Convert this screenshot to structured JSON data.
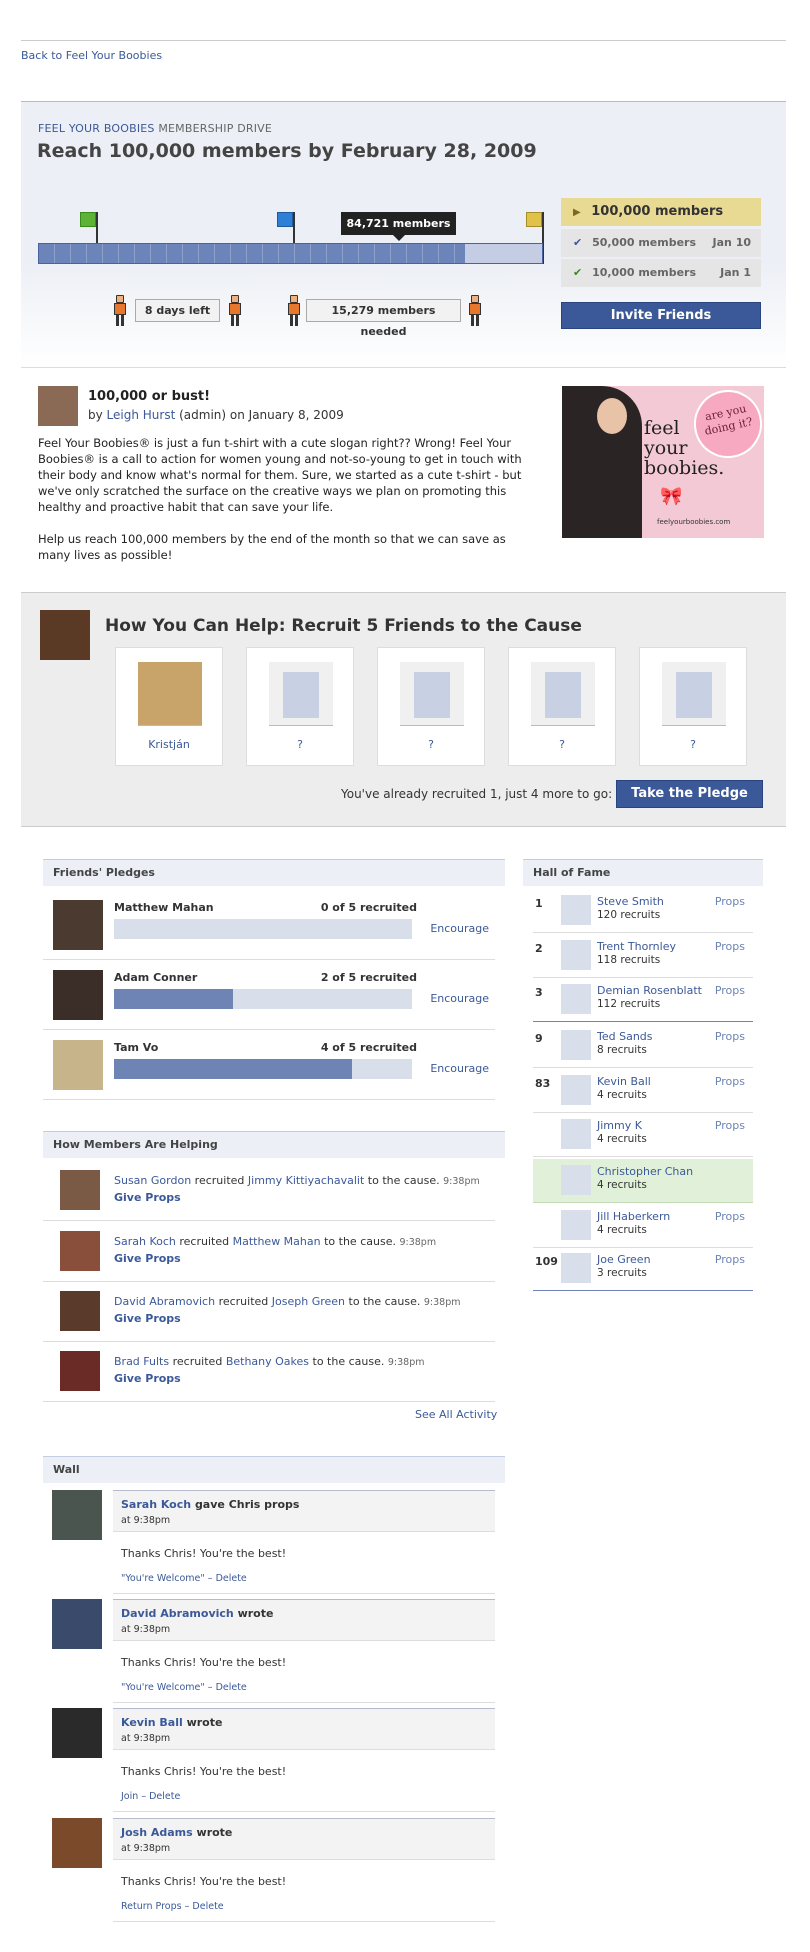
{
  "top_link": "Back to Feel Your Boobies",
  "drive": {
    "brand": "FEEL YOUR BOOBIES",
    "label": "MEMBERSHIP DRIVE",
    "title": "Reach 100,000 members by February 28, 2009",
    "progress_fraction": 0.847,
    "current_members": "84,721 members",
    "days_left": "8 days left",
    "members_needed": "15,279 members needed",
    "goals": [
      {
        "label": "100,000 members",
        "date": "",
        "state": "current"
      },
      {
        "label": "50,000 members",
        "date": "Jan 10",
        "state": "done"
      },
      {
        "label": "10,000 members",
        "date": "Jan 1",
        "state": "done"
      }
    ],
    "invite_button": "Invite Friends",
    "colors": {
      "flag_green": "#5cb335",
      "flag_blue": "#2e7fd6",
      "flag_yellow": "#e0c24a",
      "accent": "#3b5998"
    }
  },
  "post": {
    "title": "100,000 or bust!",
    "by_prefix": "by",
    "author": "Leigh Hurst",
    "by_suffix": "(admin) on January 8, 2009",
    "paragraph1": "Feel Your Boobies® is just a fun t-shirt with a cute slogan right?? Wrong! Feel Your Boobies® is a call to action for women young and not-so-young to get in touch with their body and know what's normal for them. Sure, we started as a cute t-shirt - but we've only scratched the surface on the creative ways we plan on promoting this healthy and proactive habit that can save your life.",
    "paragraph2": "Help us reach 100,000 members by the end of the month so that we can save as many lives as possible!",
    "ad": {
      "line1": "feel",
      "line2": "your",
      "line3": "boobies.",
      "badge": "are you doing it?",
      "url": "feelyourboobies.com"
    }
  },
  "recruit": {
    "title": "How You Can Help: Recruit 5 Friends to the Cause",
    "slots": [
      "Kristján",
      "?",
      "?",
      "?",
      "?"
    ],
    "status": "You've already recruited 1, just 4 more to go:",
    "button": "Take the Pledge"
  },
  "friends_pledges": {
    "header": "Friends' Pledges",
    "rows": [
      {
        "name": "Matthew Mahan",
        "count": "0 of 5 recruited",
        "fraction": 0,
        "action": "Encourage"
      },
      {
        "name": "Adam Conner",
        "count": "2 of 5 recruited",
        "fraction": 0.4,
        "action": "Encourage"
      },
      {
        "name": "Tam Vo",
        "count": "4 of 5 recruited",
        "fraction": 0.8,
        "action": "Encourage"
      }
    ]
  },
  "hall_of_fame": {
    "header": "Hall of Fame",
    "rows": [
      {
        "rank": "1",
        "name": "Steve Smith",
        "recruits": "120 recruits",
        "props": "Props"
      },
      {
        "rank": "2",
        "name": "Trent Thornley",
        "recruits": "118 recruits",
        "props": "Props"
      },
      {
        "rank": "3",
        "name": "Demian Rosenblatt",
        "recruits": "112 recruits",
        "props": "Props"
      },
      {
        "rank": "9",
        "name": "Ted Sands",
        "recruits": "8 recruits",
        "props": "Props"
      },
      {
        "rank": "83",
        "name": "Kevin Ball",
        "recruits": "4 recruits",
        "props": "Props"
      },
      {
        "rank": "",
        "name": "Jimmy K",
        "recruits": "4 recruits",
        "props": "Props"
      },
      {
        "rank": "",
        "name": "Christopher Chan",
        "recruits": "4 recruits",
        "props": ""
      },
      {
        "rank": "",
        "name": "Jill Haberkern",
        "recruits": "4 recruits",
        "props": "Props"
      },
      {
        "rank": "109",
        "name": "Joe Green",
        "recruits": "3 recruits",
        "props": "Props"
      }
    ]
  },
  "how_members": {
    "header": "How Members Are Helping",
    "items": [
      {
        "actor": "Susan Gordon",
        "verb": "recruited",
        "target": "Jimmy Kittiyachavalit",
        "tail": "to the cause.",
        "time": "9:38pm",
        "action": "Give Props"
      },
      {
        "actor": "Sarah Koch",
        "verb": "recruited",
        "target": "Matthew Mahan",
        "tail": "to the cause.",
        "time": "9:38pm",
        "action": "Give Props"
      },
      {
        "actor": "David Abramovich",
        "verb": "recruited",
        "target": "Joseph Green",
        "tail": "to the cause.",
        "time": "9:38pm",
        "action": "Give Props"
      },
      {
        "actor": "Brad Fults",
        "verb": "recruited",
        "target": "Bethany Oakes",
        "tail": "to the cause.",
        "time": "9:38pm",
        "action": "Give Props"
      }
    ],
    "see_all": "See All Activity"
  },
  "wall": {
    "header": "Wall",
    "posts": [
      {
        "name": "Sarah Koch",
        "verb": "gave Chris props",
        "at": "at 9:38pm",
        "message": "Thanks Chris! You're the best!",
        "action1": "\"You're Welcome\"",
        "sep": "–",
        "action2": "Delete"
      },
      {
        "name": "David Abramovich",
        "verb": "wrote",
        "at": "at 9:38pm",
        "message": "Thanks Chris! You're the best!",
        "action1": "\"You're Welcome\"",
        "sep": "–",
        "action2": "Delete"
      },
      {
        "name": "Kevin Ball",
        "verb": "wrote",
        "at": "at 9:38pm",
        "message": "Thanks Chris! You're the best!",
        "action1": "Join",
        "sep": "–",
        "action2": "Delete"
      },
      {
        "name": "Josh Adams",
        "verb": "wrote",
        "at": "at  9:38pm",
        "message": "Thanks Chris! You're the best!",
        "action1": "Return Props",
        "sep": "–",
        "action2": "Delete"
      }
    ]
  }
}
